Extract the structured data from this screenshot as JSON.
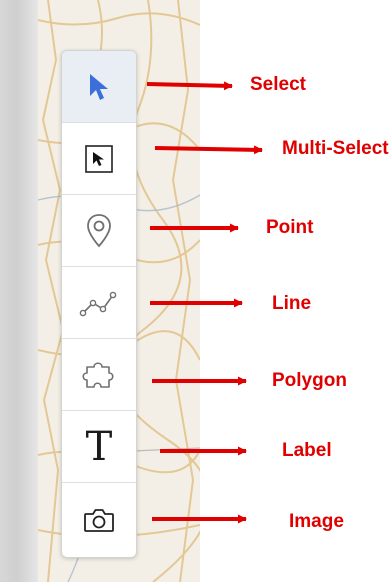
{
  "colors": {
    "annotation": "#e00000",
    "select_arrow": "#3b6fdc",
    "active_bg": "#e9eef5",
    "icon_stroke": "#707070",
    "map_road": "#e2c48d"
  },
  "toolbar": {
    "tools": [
      {
        "icon": "select-cursor-icon",
        "label": "Select"
      },
      {
        "icon": "multi-select-icon",
        "label": "Multi-Select"
      },
      {
        "icon": "map-pin-icon",
        "label": "Point"
      },
      {
        "icon": "polyline-icon",
        "label": "Line"
      },
      {
        "icon": "puzzle-polygon-icon",
        "label": "Polygon"
      },
      {
        "icon": "text-t-icon",
        "glyph": "T",
        "label": "Label"
      },
      {
        "icon": "camera-icon",
        "label": "Image"
      }
    ]
  }
}
